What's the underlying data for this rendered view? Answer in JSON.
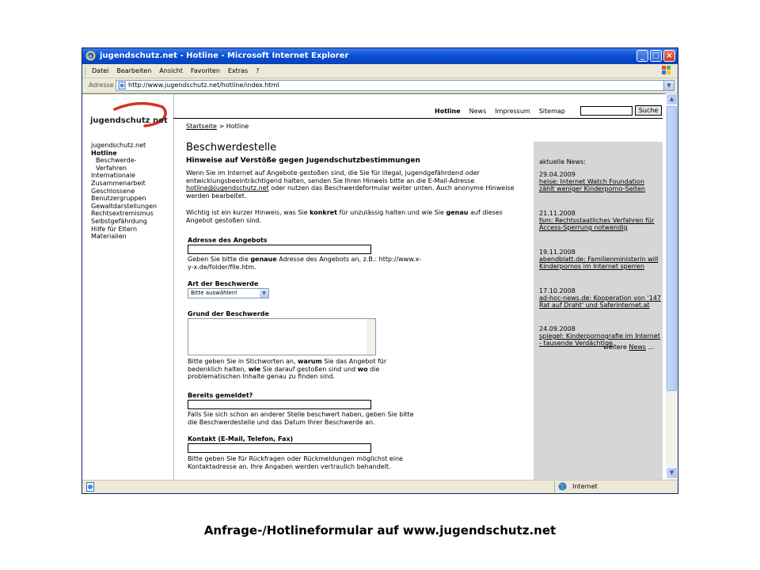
{
  "window": {
    "title": "jugendschutz.net - Hotline - Microsoft Internet Explorer"
  },
  "menubar": [
    "Datei",
    "Bearbeiten",
    "Ansicht",
    "Favoriten",
    "Extras",
    "?"
  ],
  "address": {
    "label": "Adresse",
    "url": "http://www.jugendschutz.net/hotline/index.html"
  },
  "statusbar": {
    "zone": "Internet"
  },
  "logo": {
    "text": "jugendschutz  net"
  },
  "leftnav": [
    {
      "label": "jugendschutz.net",
      "active": false,
      "sub": false
    },
    {
      "label": "Hotline",
      "active": true,
      "sub": false
    },
    {
      "label": "Beschwerde-",
      "active": false,
      "sub": true
    },
    {
      "label": "Verfahren",
      "active": false,
      "sub": true
    },
    {
      "label": "Internationale",
      "active": false,
      "sub": false
    },
    {
      "label": "Zusammenarbeit",
      "active": false,
      "sub": false
    },
    {
      "label": "Geschlossene",
      "active": false,
      "sub": false
    },
    {
      "label": "Benutzergruppen",
      "active": false,
      "sub": false
    },
    {
      "label": "Gewaltdarstellungen",
      "active": false,
      "sub": false
    },
    {
      "label": "Rechtsextremismus",
      "active": false,
      "sub": false
    },
    {
      "label": "Selbstgefährdung",
      "active": false,
      "sub": false
    },
    {
      "label": "Hilfe für Eltern",
      "active": false,
      "sub": false
    },
    {
      "label": "Materialien",
      "active": false,
      "sub": false
    }
  ],
  "topnav": {
    "hotline": "Hotline",
    "news": "News",
    "impressum": "Impressum",
    "sitemap": "Sitemap",
    "search_button": "Suche"
  },
  "breadcrumb": {
    "home": "Startseite",
    "separator": " > ",
    "current": "Hotline"
  },
  "main": {
    "title": "Beschwerdestelle",
    "headline": "Hinweise auf Verstöße gegen Jugendschutzbestimmungen",
    "intro_before": "Wenn Sie im Internet auf Angebote gestoßen sind, die Sie für illegal, jugendgefährdend oder entwicklungsbeeinträchtigend halten, senden Sie Ihren Hinweis bitte an die E-Mail-Adresse ",
    "intro_email": "hotline@jugendschutz.net",
    "intro_after": " oder nutzen das Beschwerdeformular weiter unten. Auch anonyme Hinweise werden bearbeitet.",
    "hint_1": "Wichtig ist ein kurzer Hinweis, was Sie ",
    "hint_b1": "konkret",
    "hint_2": " für unzulässig halten und wie Sie ",
    "hint_b2": "genau",
    "hint_3": " auf dieses Angebot gestoßen sind."
  },
  "form": {
    "address_label": "Adresse des Angebots",
    "address_help_1": "Geben Sie bitte die ",
    "address_help_b": "genaue",
    "address_help_2": " Adresse des Angebots an, z.B.: http://www.x-y-x.de/folder/file.htm.",
    "type_label": "Art der Beschwerde",
    "type_selected": "Bitte auswählen!",
    "reason_label": "Grund der Beschwerde",
    "reason_help_1": "Bitte geben Sie in Stichworten an, ",
    "reason_help_b1": "warum",
    "reason_help_2": " Sie das Angebot für bedenklich halten, ",
    "reason_help_b2": "wie",
    "reason_help_3": " Sie darauf gestoßen sind und ",
    "reason_help_b3": "wo",
    "reason_help_4": " die problematischen Inhalte genau zu finden sind.",
    "reported_label": "Bereits gemeldet?",
    "reported_help": "Falls Sie sich schon an anderer Stelle beschwert haben, geben Sie bitte die Beschwerdestelle und das Datum Ihrer Beschwerde an.",
    "contact_label": "Kontakt (E-Mail, Telefon, Fax)",
    "contact_help": "Bitte geben Sie für Rückfragen oder Rückmeldungen möglichst eine Kontaktadresse an. Ihre Angaben werden vertraulich behandelt."
  },
  "news": {
    "heading": "aktuelle News:",
    "items": [
      {
        "date": "29.04.2009",
        "text": "heise: Internet Watch Foundation zählt weniger Kinderporno-Seiten"
      },
      {
        "date": "21.11.2008",
        "text": "fsm: Rechtsstaatliches Verfahren für Access-Sperrung notwendig"
      },
      {
        "date": "19.11.2008",
        "text": "abendblatt.de: Familienministerin will Kinderpornos im Internet sperren"
      },
      {
        "date": "17.10.2008",
        "text": "ad-hoc-news.de: Kooperation von '147 Rat auf Draht' und Saferinternet.at"
      },
      {
        "date": "24.09.2008",
        "text": "spiegel: Kinderpornografie im Internet - tausende Verdächtige"
      }
    ],
    "more_prefix": "weitere ",
    "more_link": "News",
    "more_suffix": " ..."
  },
  "caption": "Anfrage-/Hotlineformular auf www.jugendschutz.net",
  "colors": {
    "titlebar": "#0a50d6",
    "window_chrome": "#ece9d8",
    "news_box": "#d6d6d6",
    "logo_red": "#d2341f"
  }
}
